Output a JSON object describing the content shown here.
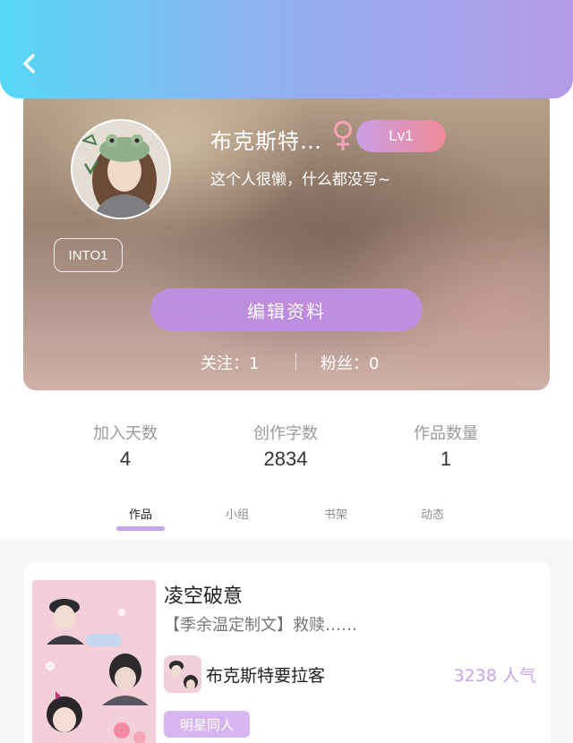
{
  "header": {
    "back_icon": "chevron-left-icon"
  },
  "profile": {
    "nickname": "布克斯特…",
    "gender_symbol": "♀",
    "level": "Lv1",
    "bio": "这个人很懒，什么都没写~",
    "tag": "INTO1",
    "edit_label": "编辑资料",
    "following_label": "关注：",
    "following_value": "1",
    "fans_label": "粉丝：",
    "fans_value": "0"
  },
  "stats": [
    {
      "label": "加入天数",
      "value": "4"
    },
    {
      "label": "创作字数",
      "value": "2834"
    },
    {
      "label": "作品数量",
      "value": "1"
    }
  ],
  "tabs": [
    {
      "label": "作品",
      "active": true
    },
    {
      "label": "小组",
      "active": false
    },
    {
      "label": "书架",
      "active": false
    },
    {
      "label": "动态",
      "active": false
    }
  ],
  "works": [
    {
      "title": "凌空破意",
      "description": "【季余温定制文】救赎……",
      "author": "布克斯特要拉客",
      "popularity": "3238 人气",
      "genre": "明星同人"
    }
  ],
  "colors": {
    "accent": "#c08fe3",
    "level_badge_start": "#c99ee6",
    "level_badge_end": "#f08a96",
    "popularity": "#c9a6ea",
    "genre_tag": "#d7b6f0"
  }
}
